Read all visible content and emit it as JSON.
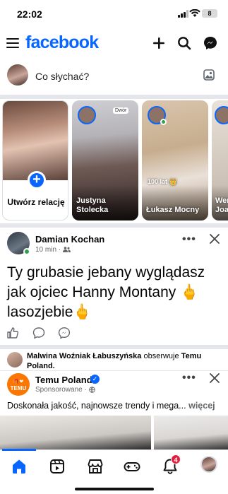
{
  "status_bar": {
    "time": "22:02",
    "battery": "8"
  },
  "header": {
    "logo": "facebook"
  },
  "composer": {
    "placeholder": "Co słychać?"
  },
  "stories": {
    "create_label": "Utwórz relację",
    "items": [
      {
        "name": "Justyna Stolecka"
      },
      {
        "name": "Łukasz Mocny",
        "caption": "100 lat 👑"
      },
      {
        "name": "Wer Joa"
      }
    ],
    "sticker": "Dwór"
  },
  "post": {
    "author": "Damian Kochan",
    "time": "10 min",
    "text": "Ty grubasie jebany wyglądasz jak ojciec Hanny Montany 🖕 lasozjebie🖕"
  },
  "suggested": {
    "follower": "Malwina Woźniak Łabuszyńska",
    "follow_text": "obserwuje",
    "page": "Temu Poland."
  },
  "ad": {
    "name": "Temu Poland",
    "sponsored": "Sponsorowane",
    "logo_text": "TEMU",
    "text": "Doskonała jakość, najnowsze trendy i mega...",
    "more": "więcej"
  },
  "nav": {
    "notification_count": "4"
  },
  "colors": {
    "brand": "#0866ff",
    "online": "#31a24c",
    "badge": "#e41e3f",
    "temu": "#fb7701"
  }
}
